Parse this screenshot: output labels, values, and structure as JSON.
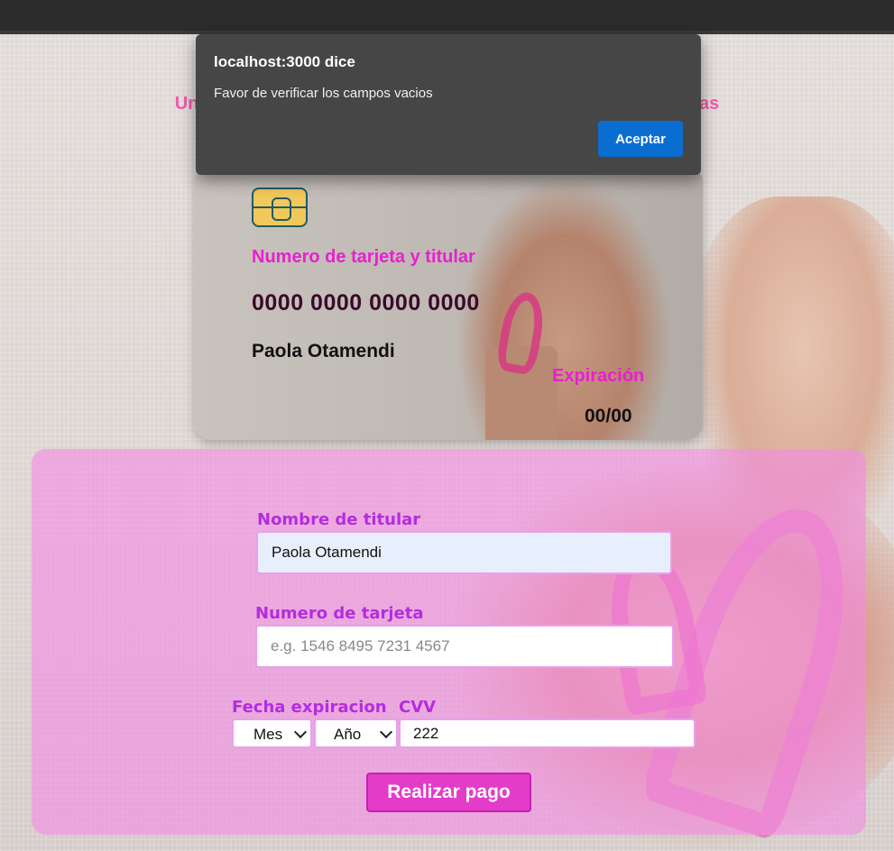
{
  "dialog": {
    "title": "localhost:3000 dice",
    "message": "Favor de verificar los campos vacios",
    "accept_label": "Aceptar"
  },
  "header": {
    "headline": "Unete a la causa, tu donativo nos ayudará a alcanzar mas vidas"
  },
  "card": {
    "number_label": "Numero de tarjeta y titular",
    "number": "0000 0000 0000 0000",
    "holder": "Paola Otamendi",
    "expiration_label": "Expiración",
    "expiration": "00/00"
  },
  "form": {
    "holder_label": "Nombre de titular",
    "holder_value": "Paola Otamendi",
    "number_label": "Numero de tarjeta",
    "number_placeholder": "e.g. 1546 8495 7231 4567",
    "expiration_label": "Fecha expiracion",
    "month_selected": "Mes",
    "year_selected": "Año",
    "cvv_label": "CVV",
    "cvv_value": "222",
    "submit_label": "Realizar pago"
  },
  "colors": {
    "accent_pink": "#f25ab0",
    "label_purple": "#b42ce0",
    "button_pink": "#e33cc9",
    "dialog_blue": "#0a6ed1"
  }
}
